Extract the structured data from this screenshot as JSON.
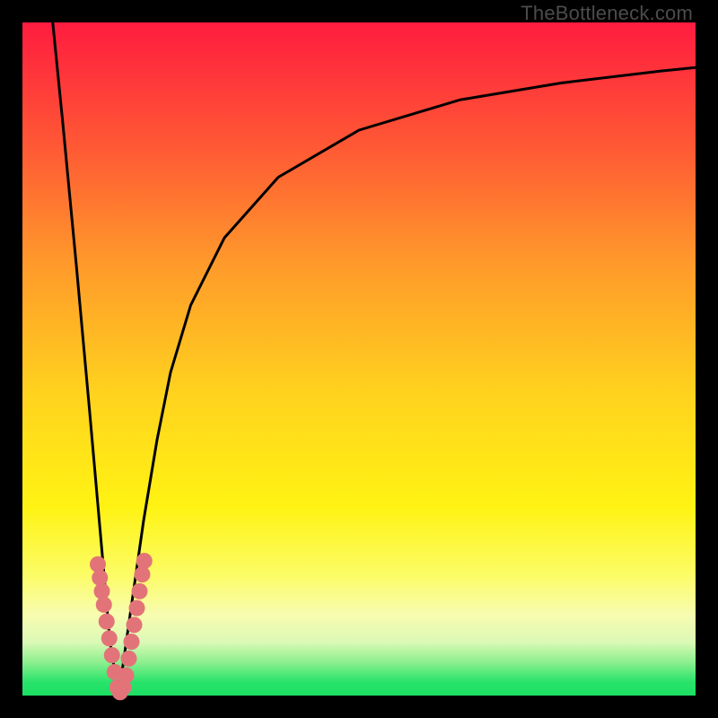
{
  "attribution": "TheBottleneck.com",
  "colors": {
    "background": "#000000",
    "curve_stroke": "#000000",
    "marker_fill": "#e27479",
    "marker_stroke": "#b84d56"
  },
  "chart_data": {
    "type": "line",
    "title": "",
    "xlabel": "",
    "ylabel": "",
    "xlim": [
      0,
      100
    ],
    "ylim": [
      0,
      100
    ],
    "grid": false,
    "legend": false,
    "series": [
      {
        "name": "left-branch",
        "x": [
          4.5,
          6,
          8,
          10,
          11.5,
          13,
          14.3
        ],
        "y": [
          100,
          85,
          64,
          42,
          25,
          8,
          0
        ]
      },
      {
        "name": "right-branch",
        "x": [
          14.3,
          16,
          18,
          20,
          22,
          25,
          30,
          38,
          50,
          65,
          80,
          95,
          100
        ],
        "y": [
          0,
          12,
          26,
          38,
          48,
          58,
          68,
          77,
          84,
          88.5,
          91,
          92.8,
          93.3
        ]
      }
    ],
    "markers": {
      "left_cluster": [
        {
          "x": 11.2,
          "y": 19.5
        },
        {
          "x": 11.5,
          "y": 17.5
        },
        {
          "x": 11.8,
          "y": 15.5
        },
        {
          "x": 12.1,
          "y": 13.5
        },
        {
          "x": 12.5,
          "y": 11.0
        },
        {
          "x": 12.9,
          "y": 8.5
        },
        {
          "x": 13.3,
          "y": 6.0
        },
        {
          "x": 13.7,
          "y": 3.5
        },
        {
          "x": 14.1,
          "y": 1.2
        }
      ],
      "right_cluster": [
        {
          "x": 14.5,
          "y": 0.5
        },
        {
          "x": 15.0,
          "y": 1.2
        },
        {
          "x": 15.4,
          "y": 3.0
        },
        {
          "x": 15.8,
          "y": 5.5
        },
        {
          "x": 16.2,
          "y": 8.0
        },
        {
          "x": 16.6,
          "y": 10.5
        },
        {
          "x": 17.0,
          "y": 13.0
        },
        {
          "x": 17.4,
          "y": 15.5
        },
        {
          "x": 17.8,
          "y": 18.0
        },
        {
          "x": 18.1,
          "y": 20.0
        }
      ]
    }
  }
}
